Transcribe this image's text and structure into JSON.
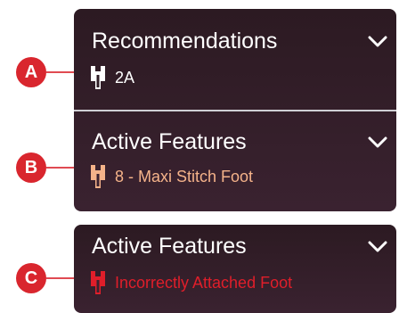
{
  "callouts": [
    {
      "letter": "A"
    },
    {
      "letter": "B"
    },
    {
      "letter": "C"
    }
  ],
  "sections": [
    {
      "title": "Recommendations",
      "value": "2A",
      "value_color": "#ffffff",
      "icon": "presser-foot-icon",
      "icon_color": "#ffffff"
    },
    {
      "title": "Active Features",
      "value": "8 - Maxi Stitch Foot",
      "value_color": "#f5b38a",
      "icon": "presser-foot-icon",
      "icon_color": "#f5b38a"
    },
    {
      "title": "Active Features",
      "value": "Incorrectly Attached Foot",
      "value_color": "#e01e2a",
      "icon": "presser-foot-icon",
      "icon_color": "#e01e2a"
    }
  ],
  "colors": {
    "panel": "#2f1d26",
    "marker": "#d9262e",
    "divider": "#cfcfd4"
  }
}
